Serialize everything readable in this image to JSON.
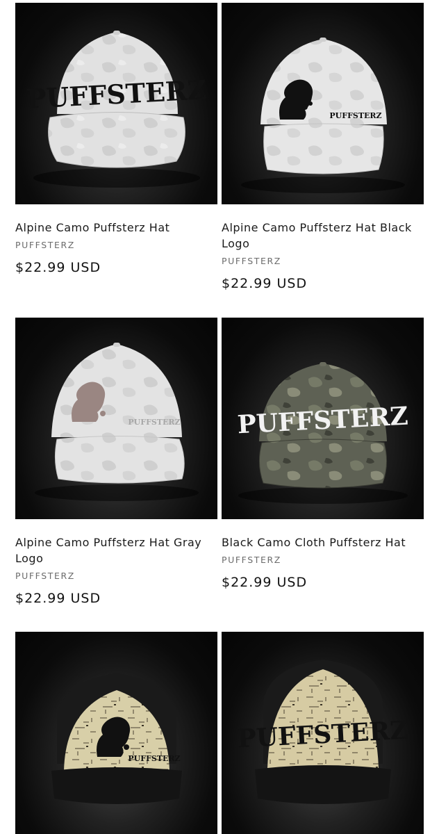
{
  "products": [
    {
      "title": "Alpine Camo Puffsterz Hat",
      "vendor": "PUFFSTERZ",
      "price": "$22.99 USD",
      "image": {
        "icon": "white-camo-cap-wordmark-black",
        "logo_text": "PUFFSTERZ",
        "hat_color": "#dedede",
        "logo_color": "#111111"
      }
    },
    {
      "title": "Alpine Camo Puffsterz Hat Black Logo",
      "vendor": "PUFFSTERZ",
      "price": "$22.99 USD",
      "image": {
        "icon": "white-camo-cap-silhouette-black",
        "logo_text": "PUFFSTERZ",
        "hat_color": "#e6e6e6",
        "logo_color": "#111111"
      }
    },
    {
      "title": "Alpine Camo Puffsterz Hat Gray Logo",
      "vendor": "PUFFSTERZ",
      "price": "$22.99 USD",
      "image": {
        "icon": "white-camo-cap-silhouette-gray",
        "logo_text": "PUFFSTERZ",
        "hat_color": "#e2e2e2",
        "logo_color": "#8c7f7b"
      }
    },
    {
      "title": "Black Camo Cloth Puffsterz Hat",
      "vendor": "PUFFSTERZ",
      "price": "$22.99 USD",
      "image": {
        "icon": "black-camo-cap-wordmark-white",
        "logo_text": "PUFFSTERZ",
        "hat_color": "#5b5e52",
        "logo_color": "#f2f2f2"
      }
    },
    {
      "title": "",
      "vendor": "",
      "price": "",
      "image": {
        "icon": "cork-cap-silhouette-black",
        "logo_text": "PUFFSTERZ",
        "hat_color": "#d8cfa8",
        "logo_color": "#111111"
      }
    },
    {
      "title": "",
      "vendor": "",
      "price": "",
      "image": {
        "icon": "cork-cap-wordmark-black",
        "logo_text": "PUFFSTERZ",
        "hat_color": "#d6cba3",
        "logo_color": "#111111"
      }
    }
  ]
}
